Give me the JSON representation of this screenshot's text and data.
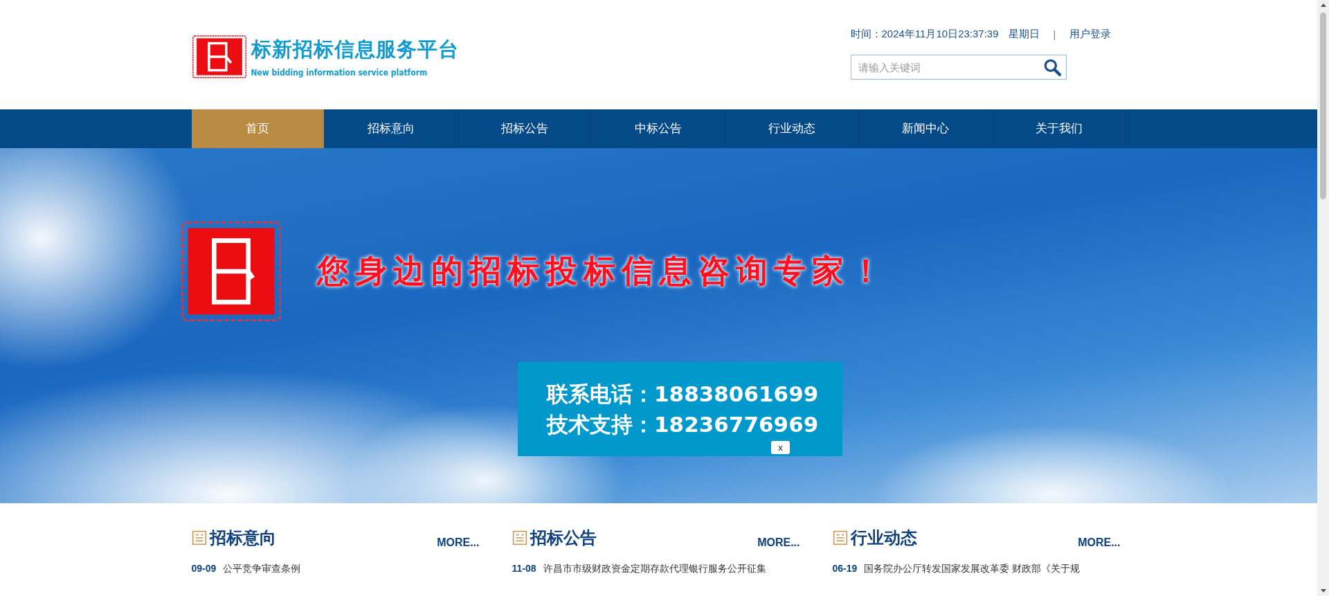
{
  "header": {
    "logo": {
      "title": "标新招标信息服务平台",
      "subtitle": "New bidding information service platform"
    },
    "datetime": "时间：2024年11月10日23:37:39",
    "weekday": "星期日",
    "separator": "|",
    "login": "用户登录",
    "search": {
      "placeholder": "请输入关键词"
    }
  },
  "nav": {
    "items": [
      {
        "label": "首页",
        "selected": true
      },
      {
        "label": "招标意向",
        "selected": false
      },
      {
        "label": "招标公告",
        "selected": false
      },
      {
        "label": "中标公告",
        "selected": false
      },
      {
        "label": "行业动态",
        "selected": false
      },
      {
        "label": "新闻中心",
        "selected": false
      },
      {
        "label": "关于我们",
        "selected": false
      }
    ]
  },
  "banner": {
    "slogan": "您身边的招标投标信息咨询专家！",
    "contact": {
      "lines": [
        "联系电话：18838061699",
        "技术支持：18236776969"
      ],
      "close": "x"
    }
  },
  "sections": [
    {
      "title": "招标意向",
      "more": "MORE...",
      "rows": [
        {
          "date": "09-09",
          "title": "公平竞争审查条例"
        }
      ]
    },
    {
      "title": "招标公告",
      "more": "MORE...",
      "rows": [
        {
          "date": "11-08",
          "title": "许昌市市级财政资金定期存款代理银行服务公开征集"
        }
      ]
    },
    {
      "title": "行业动态",
      "more": "MORE...",
      "rows": [
        {
          "date": "06-19",
          "title": "国务院办公厅转发国家发展改革委 财政部《关于规"
        }
      ]
    }
  ]
}
